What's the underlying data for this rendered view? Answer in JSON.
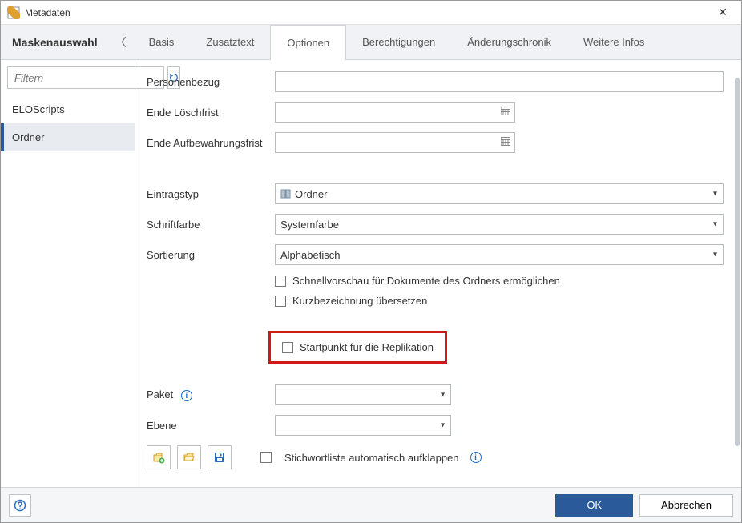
{
  "window": {
    "title": "Metadaten"
  },
  "tabbar": {
    "mask_label": "Maskenauswahl",
    "tabs": [
      "Basis",
      "Zusatztext",
      "Optionen",
      "Berechtigungen",
      "Änderungschronik",
      "Weitere Infos"
    ],
    "active_index": 2
  },
  "sidebar": {
    "filter_placeholder": "Filtern",
    "items": [
      "ELOScripts",
      "Ordner"
    ],
    "selected_index": 1
  },
  "form": {
    "personenbezug_label": "Personenbezug",
    "personenbezug_value": "",
    "ende_loeschfrist_label": "Ende Löschfrist",
    "ende_loeschfrist_value": "",
    "ende_aufbewahrung_label": "Ende Aufbewahrungsfrist",
    "ende_aufbewahrung_value": "",
    "eintragstyp_label": "Eintragstyp",
    "eintragstyp_value": "Ordner",
    "schriftfarbe_label": "Schriftfarbe",
    "schriftfarbe_value": "Systemfarbe",
    "sortierung_label": "Sortierung",
    "sortierung_value": "Alphabetisch",
    "chk_schnellvorschau": "Schnellvorschau für Dokumente des Ordners ermöglichen",
    "chk_kurzbezeichnung": "Kurzbezeichnung übersetzen",
    "chk_startpunkt": "Startpunkt für die Replikation",
    "paket_label": "Paket",
    "paket_value": "",
    "ebene_label": "Ebene",
    "ebene_value": "",
    "chk_stichwortliste": "Stichwortliste automatisch aufklappen"
  },
  "footer": {
    "ok": "OK",
    "cancel": "Abbrechen"
  }
}
